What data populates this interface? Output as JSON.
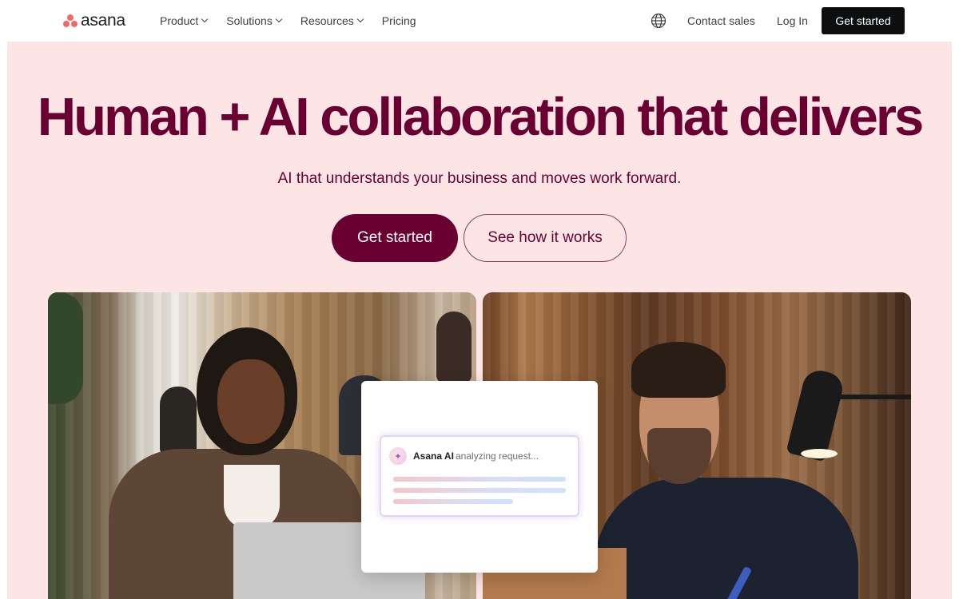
{
  "nav": {
    "logo_text": "asana",
    "menu": [
      {
        "label": "Product",
        "has_dropdown": true
      },
      {
        "label": "Solutions",
        "has_dropdown": true
      },
      {
        "label": "Resources",
        "has_dropdown": true
      },
      {
        "label": "Pricing",
        "has_dropdown": false
      }
    ],
    "language_icon": "globe-icon",
    "contact_label": "Contact sales",
    "login_label": "Log In",
    "cta_label": "Get started"
  },
  "hero": {
    "title": "Human + AI collaboration that delivers",
    "subtitle": "AI that understands your business and moves work forward.",
    "primary_cta": "Get started",
    "secondary_cta": "See how it works"
  },
  "ai_card": {
    "name": "Asana AI",
    "status": "analyzing request..."
  },
  "colors": {
    "brand_logo": "#f06a6a",
    "hero_background": "#fde5e6",
    "hero_text": "#690031",
    "primary_button": "#690031",
    "nav_cta": "#0d0e10"
  }
}
